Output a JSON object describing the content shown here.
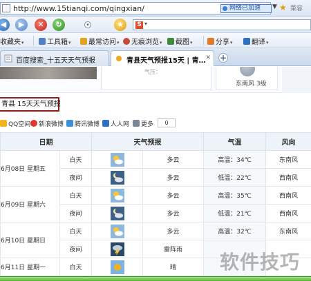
{
  "address_bar": {
    "url": "http://www.15tianqi.com/qingxian/",
    "speed_badge": "网络已加速",
    "favorites": "菜容"
  },
  "toolbar": {
    "items": [
      {
        "label": "收藏夹"
      },
      {
        "label": "工具箱"
      },
      {
        "label": "最常访问"
      },
      {
        "label": "无痕浏览"
      },
      {
        "label": "截图"
      },
      {
        "label": "分享"
      },
      {
        "label": "翻译"
      }
    ]
  },
  "tabs": [
    {
      "label": "百度搜索_十五天天气预报"
    },
    {
      "label": "青县天气预报15天 | 青…"
    }
  ],
  "page": {
    "top_card_text": "气压：",
    "wind_text": "东南风  3级",
    "title": "青县 15天天气预报",
    "share": [
      {
        "label": "QQ空间"
      },
      {
        "label": "新浪微博"
      },
      {
        "label": "腾讯微博"
      },
      {
        "label": "人人网"
      },
      {
        "label": "更多"
      }
    ],
    "share_count": "0"
  },
  "forecast": {
    "headers": [
      "日期",
      "天气预报",
      "气温",
      "风向"
    ],
    "rows": [
      {
        "date": "6月08日  星期五",
        "period": "白天",
        "icon": "partly-cloudy-sun-icon",
        "weather": "多云",
        "temp": "高温：34℃",
        "wind": "东南风"
      },
      {
        "date": "",
        "period": "夜间",
        "icon": "partly-cloudy-moon-icon",
        "weather": "多云",
        "temp": "低温：22℃",
        "wind": "西南风"
      },
      {
        "date": "6月09日  星期六",
        "period": "白天",
        "icon": "partly-cloudy-sun-icon",
        "weather": "多云",
        "temp": "高温：35℃",
        "wind": "西南风"
      },
      {
        "date": "",
        "period": "夜间",
        "icon": "partly-cloudy-moon-icon",
        "weather": "多云",
        "temp": "低温：21℃",
        "wind": "西南风"
      },
      {
        "date": "6月10日  星期日",
        "period": "白天",
        "icon": "partly-cloudy-sun-icon",
        "weather": "多云",
        "temp": "高温：32℃",
        "wind": "东南风"
      },
      {
        "date": "",
        "period": "夜间",
        "icon": "thunderstorm-icon",
        "weather": "雷阵雨",
        "temp": "",
        "wind": ""
      },
      {
        "date": "6月11日  星期一",
        "period": "白天",
        "icon": "sunny-icon",
        "weather": "晴",
        "temp": "",
        "wind": ""
      }
    ]
  },
  "watermark": "软件技巧"
}
